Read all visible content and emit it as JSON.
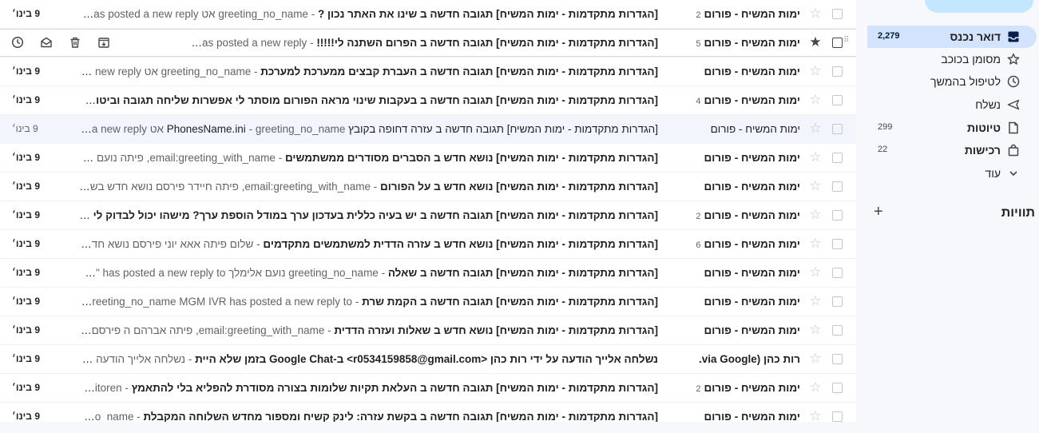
{
  "nav": {
    "items": [
      {
        "label": "דואר נכנס",
        "count": "2,279",
        "icon": "inbox-icon",
        "active": true,
        "bold": true
      },
      {
        "label": "מסומן בכוכב",
        "count": "",
        "icon": "star-icon",
        "active": false,
        "bold": false
      },
      {
        "label": "לטיפול בהמשך",
        "count": "",
        "icon": "clock-icon",
        "active": false,
        "bold": false
      },
      {
        "label": "נשלח",
        "count": "",
        "icon": "send-icon",
        "active": false,
        "bold": false
      },
      {
        "label": "טיוטות",
        "count": "299",
        "icon": "draft-icon",
        "active": false,
        "bold": true
      },
      {
        "label": "רכישות",
        "count": "22",
        "icon": "purchases-icon",
        "active": false,
        "bold": true
      },
      {
        "label": "עוד",
        "count": "",
        "icon": "chevron-down-icon",
        "active": false,
        "bold": false
      }
    ],
    "labels_title": "תוויות"
  },
  "messages": [
    {
      "sender": "ימות המשיח - פורום",
      "count": "2",
      "subject": "[הגדרות מתקדמות - ימות המשיח] תגובה חדשה ב שינו את האתר נכון ?",
      "snippet": "greeting_no_name אט A has posted a new reply \"...",
      "date": "9 בינו׳",
      "read": false,
      "hovered": false
    },
    {
      "sender": "ימות המשיח - פורום",
      "count": "5",
      "subject": "[הגדרות מתקדמות - ימות המשיח] תגובה חדשה ב הפרום השתנה לי!!!!!",
      "snippet": "to- name 565906 has posted a new reply...",
      "date": "",
      "read": false,
      "hovered": true
    },
    {
      "sender": "ימות המשיח - פורום",
      "count": "",
      "subject": "[הגדרות מתקדמות - ימות המשיח] תגובה חדשה ב העברת קבצים ממערכת למערכת",
      "snippet": "greeting_no_name אט ed a new reply...",
      "date": "9 בינו׳",
      "read": false,
      "hovered": false
    },
    {
      "sender": "ימות המשיח - פורום",
      "count": "4",
      "subject": "[הגדרות מתקדמות - ימות המשיח] תגובה חדשה ב בעקבות שינוי מראה הפורום מוסתר לי אפשרות שליחה תגובה וביטול ופ...",
      "snippet": "",
      "date": "9 בינו׳",
      "read": false,
      "hovered": false
    },
    {
      "sender": "ימות המשיח - פורום",
      "count": "",
      "subject": "[הגדרות מתקדמות - ימות המשיח] תגובה חדשה ב עזרה דחופה בקובץ PhonesName.ini",
      "snippet": "greeting_no_name אט sted a new reply...",
      "date": "9 בינו׳",
      "read": true,
      "hovered": false
    },
    {
      "sender": "ימות המשיח - פורום",
      "count": "",
      "subject": "[הגדרות מתקדמות - ימות המשיח] נושא חדש ב הסברים מסודרים ממשתמשים",
      "snippet": "email:greeting_with_name, פיתה נועם אלימ...",
      "date": "9 בינו׳",
      "read": false,
      "hovered": false
    },
    {
      "sender": "ימות המשיח - פורום",
      "count": "",
      "subject": "[הגדרות מתקדמות - ימות המשיח] נושא חדש ב על הפורום",
      "snippet": "email:greeting_with_name, פיתה חיידר פירסם נושא חדש בשם \"ב...",
      "date": "9 בינו׳",
      "read": false,
      "hovered": false
    },
    {
      "sender": "ימות המשיח - פורום",
      "count": "2",
      "subject": "[הגדרות מתקדמות - ימות המשיח] תגובה חדשה ב יש בעיה כללית בעדכון ערך במודל הוספת ערך? מישהו יכול לבדוק לי אם ...",
      "snippet": "",
      "date": "9 בינו׳",
      "read": false,
      "hovered": false
    },
    {
      "sender": "ימות המשיח - פורום",
      "count": "6",
      "subject": "[הגדרות מתקדמות - ימות המשיח] נושא חדש ב עזרה הדדית למשתמשים מתקדמים",
      "snippet": "שלום פיתה אאא יוני פירסם נושא חדש ב...",
      "date": "9 בינו׳",
      "read": false,
      "hovered": false
    },
    {
      "sender": "ימות המשיח - פורום",
      "count": "",
      "subject": "[הגדרות מתקדמות - ימות המשיח] תגובה חדשה ב שאלה",
      "snippet": "greeting_no_name נועם אלימלך has posted a new reply to \"שאלה...",
      "date": "9 בינו׳",
      "read": false,
      "hovered": false
    },
    {
      "sender": "ימות המשיח - פורום",
      "count": "",
      "subject": "[הגדרות מתקדמות - ימות המשיח] תגובה חדשה ב הקמת שרת",
      "snippet": "greeting_no_name MGM IVR has posted a new reply to \"הק...",
      "date": "9 בינו׳",
      "read": false,
      "hovered": false
    },
    {
      "sender": "ימות המשיח - פורום",
      "count": "",
      "subject": "[הגדרות מתקדמות - ימות המשיח] נושא חדש ב שאלות ועזרה הדדית",
      "snippet": "email:greeting_with_name, פיתה אברהם ה פירסם נוש...",
      "date": "9 בינו׳",
      "read": false,
      "hovered": false
    },
    {
      "sender": "רות כהן (via Google.",
      "count": "",
      "subject": "נשלחה אלייך הודעה על ידי רות כהן <r0534159858@gmail.com> ב-Google Chat בזמן שלא היית",
      "snippet": "נשלחה אלייך הודעה על ידי ...",
      "date": "9 בינו׳",
      "read": false,
      "hovered": false
    },
    {
      "sender": "ימות המשיח - פורום",
      "count": "2",
      "subject": "[הגדרות מתקדמות - ימות המשיח] תגובה חדשה ב העלאת תקיות שלומות בצורה מסודרת להפליא בלי להתאמץ",
      "snippet": "e lavitoren...",
      "date": "9 בינו׳",
      "read": false,
      "hovered": false
    },
    {
      "sender": "ימות המשיח - פורום",
      "count": "",
      "subject": "[הגדרות מתקדמות - ימות המשיח] תגובה חדשה ב בקשת עזרה: לינק קשיח ומספור מחדש השלוחה המקבלת",
      "snippet": "ing_no_name...",
      "date": "9 בינו׳",
      "read": false,
      "hovered": false
    }
  ]
}
